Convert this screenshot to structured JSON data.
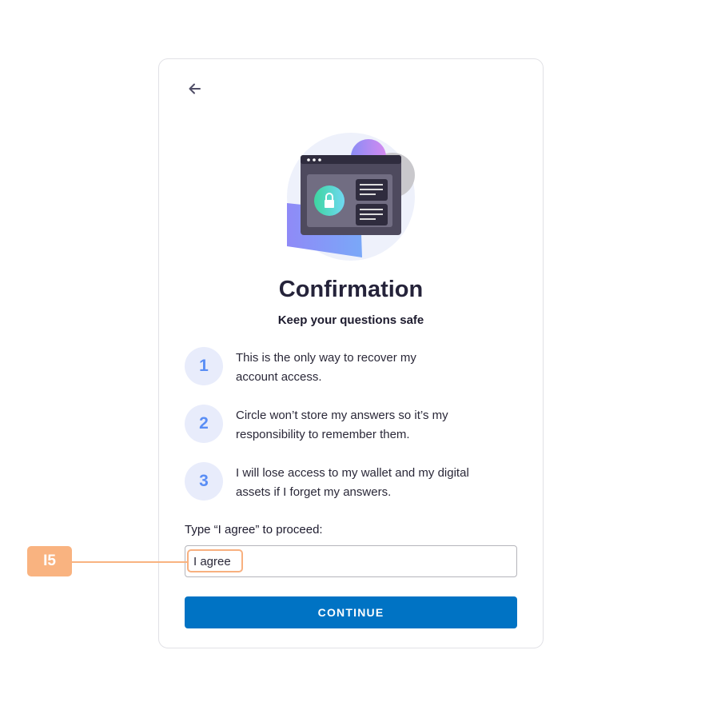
{
  "header": {
    "back_icon": "arrow-left-icon"
  },
  "illustration": {
    "icon": "browser-lock-illustration"
  },
  "title": "Confirmation",
  "subtitle": "Keep your questions safe",
  "steps": [
    {
      "number": "1",
      "text": "This is the only way to recover my account access."
    },
    {
      "number": "2",
      "text": "Circle won’t store my answers so it’s my responsibility to remember them."
    },
    {
      "number": "3",
      "text": "I will lose access to my wallet and my digital assets if I forget my answers."
    }
  ],
  "form": {
    "label": "Type “I agree” to proceed:",
    "value": "I agree",
    "button": "CONTINUE"
  },
  "annotation": {
    "label": "I5",
    "color": "#f9b380"
  },
  "colors": {
    "primary": "#0073c4",
    "step_number": "#5a8ef5",
    "step_bg": "#e8ecfb"
  }
}
